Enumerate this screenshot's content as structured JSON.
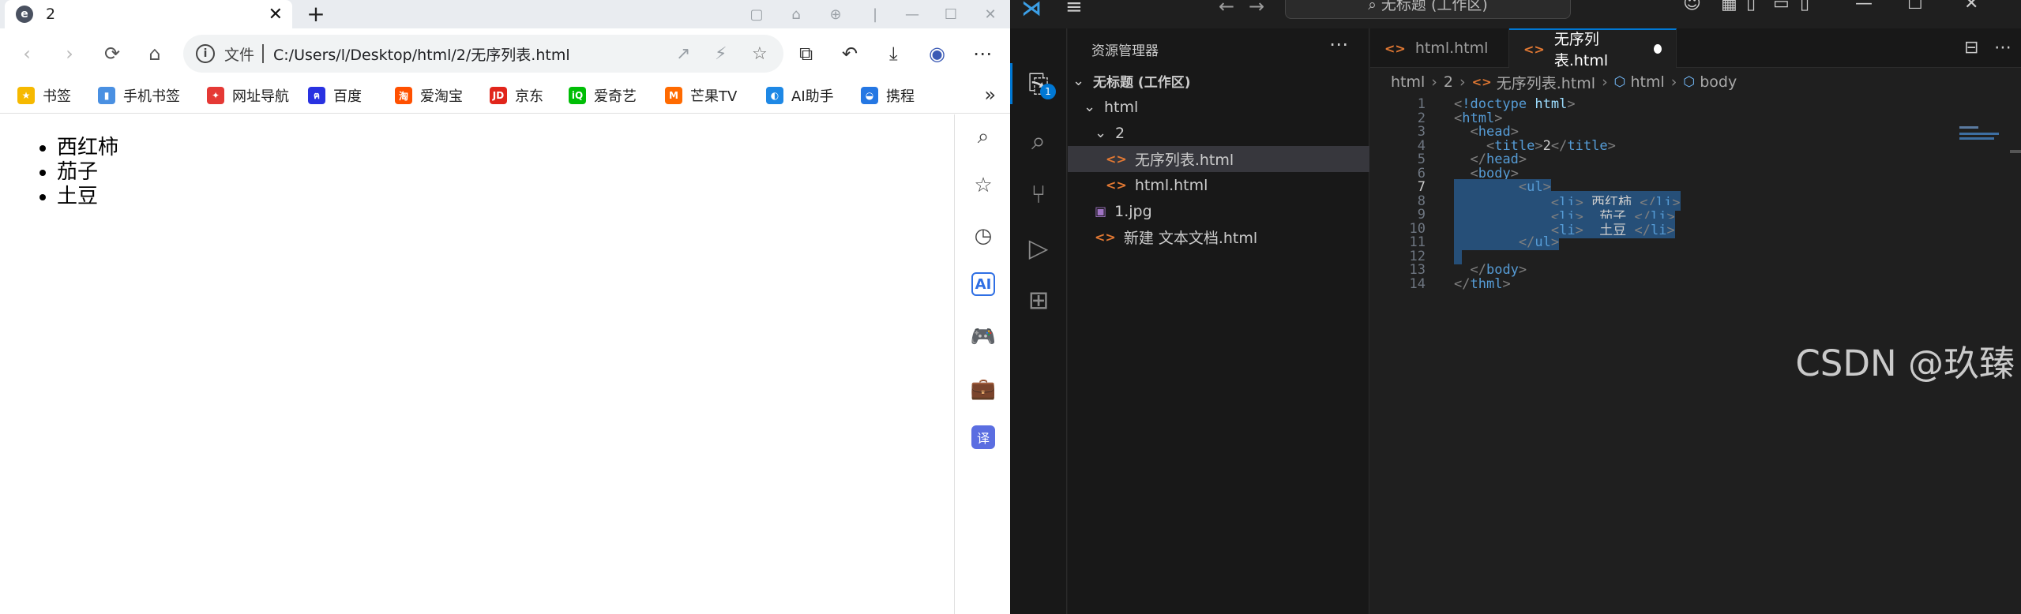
{
  "browser": {
    "tab": {
      "title": "2",
      "close": "✕"
    },
    "new_tab": "+",
    "window_controls": [
      "▢",
      "⌂",
      "⊕",
      "|",
      "—",
      "☐",
      "✕"
    ],
    "toolbar": {
      "back": "‹",
      "forward": "›",
      "reload": "⟳",
      "home": "⌂",
      "file_label": "文件",
      "url": "C:/Users/l/Desktop/html/2/无序列表.html",
      "info_icon": "i",
      "right_icons": [
        "↗",
        "⚡",
        "☆",
        "⧉",
        "↶",
        "⤓",
        "◉",
        "⋯"
      ]
    },
    "bookmarks": [
      {
        "label": "书签",
        "icon": "★",
        "color": "#f6b900"
      },
      {
        "label": "手机书签",
        "icon": "▮",
        "color": "#4a90e2"
      },
      {
        "label": "网址导航",
        "icon": "✦",
        "color": "#e53935"
      },
      {
        "label": "百度",
        "icon": "ฅ",
        "color": "#2932e1"
      },
      {
        "label": "爱淘宝",
        "icon": "淘",
        "color": "#ff5000"
      },
      {
        "label": "京东",
        "icon": "JD",
        "color": "#e1251b"
      },
      {
        "label": "爱奇艺",
        "icon": "iQ",
        "color": "#00be06"
      },
      {
        "label": "芒果TV",
        "icon": "M",
        "color": "#ff6a00"
      },
      {
        "label": "AI助手",
        "icon": "◐",
        "color": "#1e88e5"
      },
      {
        "label": "携程",
        "icon": "◒",
        "color": "#2577e3"
      }
    ],
    "bookmarks_more": "»",
    "page_list": [
      "西红柿",
      "茄子",
      "土豆"
    ],
    "side_icons": [
      "⌕",
      "☆",
      "◷",
      "AI",
      "🎮",
      "💼",
      "译"
    ]
  },
  "vscode": {
    "title": "无标题 (工作区)",
    "menu_icon": "≡",
    "nav_back": "←",
    "nav_forward": "→",
    "search_text": "⌕ 无标题 (工作区)",
    "title_actions": [
      "☺",
      "▦",
      "▯",
      "▭",
      "▯",
      "—",
      "☐",
      "✕"
    ],
    "activity": [
      "⎘",
      "⌕",
      "⑂",
      "▷",
      "⊞"
    ],
    "explorer_badge": "1",
    "explorer": {
      "header": "资源管理器",
      "more": "⋯",
      "workspace": "无标题 (工作区)",
      "tree": [
        {
          "label": "html",
          "chev": "⌄",
          "indent": 1
        },
        {
          "label": "2",
          "chev": "⌄",
          "indent": 2
        },
        {
          "label": "无序列表.html",
          "icon": "<>",
          "indent": 3,
          "selected": true
        },
        {
          "label": "html.html",
          "icon": "<>",
          "indent": 3
        },
        {
          "label": "1.jpg",
          "icon": "▣",
          "indent": 2
        },
        {
          "label": "新建 文本文档.html",
          "icon": "<>",
          "indent": 2
        }
      ]
    },
    "tabs": [
      {
        "label": "html.html",
        "icon": "<>"
      },
      {
        "label": "无序列表.html",
        "icon": "<>",
        "active": true,
        "dirty": true
      }
    ],
    "editor_actions": [
      "⊟",
      "⋯"
    ],
    "breadcrumb": [
      "html",
      "2",
      "无序列表.html",
      "html",
      "body"
    ],
    "code": [
      "<!doctype html>",
      "<html>",
      "  <head>",
      "    <title>2</title>",
      "  </head>",
      "  <body>",
      "        <ul>",
      "            <li> 西红柿 </li>",
      "            <li>  茄子 </li>",
      "            <li>  土豆 </li>",
      "        </ul>",
      "",
      "  </body>",
      "</thml>"
    ],
    "current_line": 7,
    "selected_lines": [
      7,
      8,
      9,
      10,
      11,
      12
    ]
  },
  "watermark": "CSDN @玖臻"
}
